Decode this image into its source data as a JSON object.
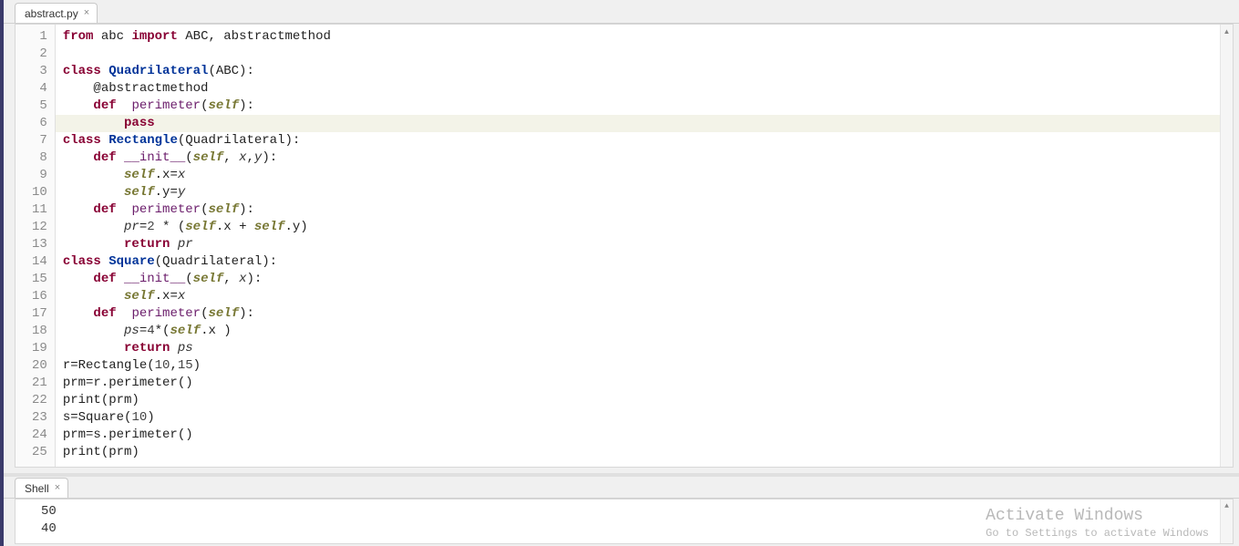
{
  "editor_tab": {
    "name": "abstract.py"
  },
  "code": {
    "lines": [
      {
        "n": 1,
        "tokens": [
          [
            "kw",
            "from"
          ],
          [
            "",
            " abc "
          ],
          [
            "kw",
            "import"
          ],
          [
            "",
            " ABC, abstractmethod"
          ]
        ]
      },
      {
        "n": 2,
        "tokens": []
      },
      {
        "n": 3,
        "tokens": [
          [
            "kw",
            "class"
          ],
          [
            "",
            " "
          ],
          [
            "def",
            "Quadrilateral"
          ],
          [
            "",
            "(ABC):"
          ]
        ]
      },
      {
        "n": 4,
        "tokens": [
          [
            "",
            "    @abstractmethod"
          ]
        ]
      },
      {
        "n": 5,
        "tokens": [
          [
            "",
            "    "
          ],
          [
            "kw",
            "def"
          ],
          [
            "",
            "  "
          ],
          [
            "fn",
            "perimeter"
          ],
          [
            "",
            "("
          ],
          [
            "self",
            "self"
          ],
          [
            "",
            "):"
          ]
        ]
      },
      {
        "n": 6,
        "hl": true,
        "tokens": [
          [
            "",
            "        "
          ],
          [
            "kw",
            "pass"
          ]
        ]
      },
      {
        "n": 7,
        "tokens": [
          [
            "kw",
            "class"
          ],
          [
            "",
            " "
          ],
          [
            "def",
            "Rectangle"
          ],
          [
            "",
            "(Quadrilateral):"
          ]
        ]
      },
      {
        "n": 8,
        "tokens": [
          [
            "",
            "    "
          ],
          [
            "kw",
            "def"
          ],
          [
            "",
            " "
          ],
          [
            "fn",
            "__init__"
          ],
          [
            "",
            "("
          ],
          [
            "self",
            "self"
          ],
          [
            "",
            ", "
          ],
          [
            "var",
            "x"
          ],
          [
            "",
            ","
          ],
          [
            "var",
            "y"
          ],
          [
            "",
            "):"
          ]
        ]
      },
      {
        "n": 9,
        "tokens": [
          [
            "",
            "        "
          ],
          [
            "self",
            "self"
          ],
          [
            "",
            ".x="
          ],
          [
            "var",
            "x"
          ]
        ]
      },
      {
        "n": 10,
        "tokens": [
          [
            "",
            "        "
          ],
          [
            "self",
            "self"
          ],
          [
            "",
            ".y="
          ],
          [
            "var",
            "y"
          ]
        ]
      },
      {
        "n": 11,
        "tokens": [
          [
            "",
            "    "
          ],
          [
            "kw",
            "def"
          ],
          [
            "",
            "  "
          ],
          [
            "fn",
            "perimeter"
          ],
          [
            "",
            "("
          ],
          [
            "self",
            "self"
          ],
          [
            "",
            "):"
          ]
        ]
      },
      {
        "n": 12,
        "tokens": [
          [
            "",
            "        "
          ],
          [
            "var",
            "pr"
          ],
          [
            "",
            "="
          ],
          [
            "num",
            "2"
          ],
          [
            "",
            " * ("
          ],
          [
            "self",
            "self"
          ],
          [
            "",
            ".x + "
          ],
          [
            "self",
            "self"
          ],
          [
            "",
            ".y)"
          ]
        ]
      },
      {
        "n": 13,
        "tokens": [
          [
            "",
            "        "
          ],
          [
            "kw",
            "return"
          ],
          [
            "",
            " "
          ],
          [
            "var",
            "pr"
          ]
        ]
      },
      {
        "n": 14,
        "tokens": [
          [
            "kw",
            "class"
          ],
          [
            "",
            " "
          ],
          [
            "def",
            "Square"
          ],
          [
            "",
            "(Quadrilateral):"
          ]
        ]
      },
      {
        "n": 15,
        "tokens": [
          [
            "",
            "    "
          ],
          [
            "kw",
            "def"
          ],
          [
            "",
            " "
          ],
          [
            "fn",
            "__init__"
          ],
          [
            "",
            "("
          ],
          [
            "self",
            "self"
          ],
          [
            "",
            ", "
          ],
          [
            "var",
            "x"
          ],
          [
            "",
            "):"
          ]
        ]
      },
      {
        "n": 16,
        "tokens": [
          [
            "",
            "        "
          ],
          [
            "self",
            "self"
          ],
          [
            "",
            ".x="
          ],
          [
            "var",
            "x"
          ]
        ]
      },
      {
        "n": 17,
        "tokens": [
          [
            "",
            "    "
          ],
          [
            "kw",
            "def"
          ],
          [
            "",
            "  "
          ],
          [
            "fn",
            "perimeter"
          ],
          [
            "",
            "("
          ],
          [
            "self",
            "self"
          ],
          [
            "",
            "):"
          ]
        ]
      },
      {
        "n": 18,
        "tokens": [
          [
            "",
            "        "
          ],
          [
            "var",
            "ps"
          ],
          [
            "",
            "="
          ],
          [
            "num",
            "4"
          ],
          [
            "",
            "*("
          ],
          [
            "self",
            "self"
          ],
          [
            "",
            ".x )"
          ]
        ]
      },
      {
        "n": 19,
        "tokens": [
          [
            "",
            "        "
          ],
          [
            "kw",
            "return"
          ],
          [
            "",
            " "
          ],
          [
            "var",
            "ps"
          ]
        ]
      },
      {
        "n": 20,
        "tokens": [
          [
            "",
            "r=Rectangle("
          ],
          [
            "num",
            "10"
          ],
          [
            "",
            ","
          ],
          [
            "num",
            "15"
          ],
          [
            "",
            ")"
          ]
        ]
      },
      {
        "n": 21,
        "tokens": [
          [
            "",
            "prm=r.perimeter()"
          ]
        ]
      },
      {
        "n": 22,
        "tokens": [
          [
            "",
            "print(prm)"
          ]
        ]
      },
      {
        "n": 23,
        "tokens": [
          [
            "",
            "s=Square("
          ],
          [
            "num",
            "10"
          ],
          [
            "",
            ")"
          ]
        ]
      },
      {
        "n": 24,
        "tokens": [
          [
            "",
            "prm=s.perimeter()"
          ]
        ]
      },
      {
        "n": 25,
        "tokens": [
          [
            "",
            "print(prm)"
          ]
        ]
      }
    ]
  },
  "shell_tab": {
    "name": "Shell"
  },
  "shell": {
    "output": [
      "50",
      "40"
    ]
  },
  "watermark": {
    "title": "Activate Windows",
    "sub": "Go to Settings to activate Windows"
  }
}
